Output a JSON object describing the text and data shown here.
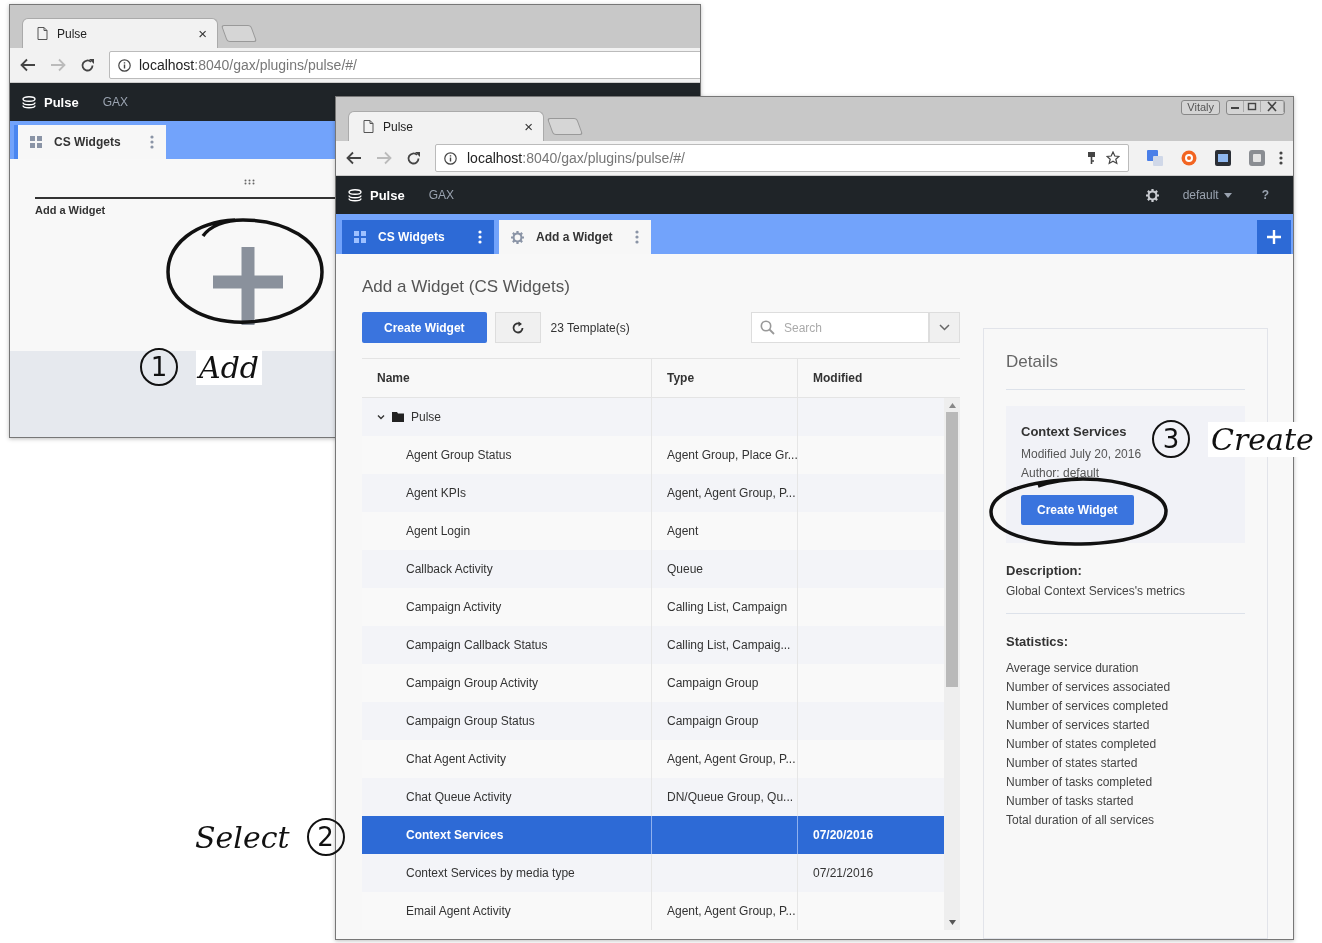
{
  "back_window": {
    "tab": {
      "title": "Pulse",
      "close": "×"
    },
    "address": {
      "host": "localhost",
      "path": ":8040/gax/plugins/pulse/#/"
    },
    "app_name": "Pulse",
    "nav_link": "GAX",
    "tabs": [
      {
        "label": "CS Widgets",
        "selected": true
      }
    ],
    "widget_label": "Add a Widget"
  },
  "front_window": {
    "user_badge": "Vitaly",
    "tab": {
      "title": "Pulse",
      "close": "×"
    },
    "address": {
      "host": "localhost",
      "path": ":8040/gax/plugins/pulse/#/"
    },
    "app_name": "Pulse",
    "nav_link": "GAX",
    "user_menu": "default",
    "help": "?",
    "tabs": [
      {
        "label": "CS Widgets",
        "kind": "grid",
        "selected": false
      },
      {
        "label": "Add a Widget",
        "kind": "gear",
        "selected": true
      }
    ],
    "page_title": "Add a Widget (CS Widgets)",
    "create_button": "Create Widget",
    "template_count": "23 Template(s)",
    "search": {
      "placeholder": "Search"
    },
    "table": {
      "columns": [
        "Name",
        "Type",
        "Modified"
      ],
      "rows": [
        {
          "name": "Pulse",
          "kind": "folder",
          "expanded": true,
          "children": [
            {
              "name": "Agent Group Status",
              "type": "Agent Group, Place Gr...",
              "selected": false
            },
            {
              "name": "Agent KPIs",
              "type": "Agent, Agent Group, P...",
              "selected": false
            },
            {
              "name": "Agent Login",
              "type": "Agent",
              "selected": false
            },
            {
              "name": "Callback Activity",
              "type": "Queue",
              "selected": false
            },
            {
              "name": "Campaign Activity",
              "type": "Calling List, Campaign",
              "selected": false
            },
            {
              "name": "Campaign Callback Status",
              "type": "Calling List, Campaig...",
              "selected": false
            },
            {
              "name": "Campaign Group Activity",
              "type": "Campaign Group",
              "selected": false
            },
            {
              "name": "Campaign Group Status",
              "type": "Campaign Group",
              "selected": false
            },
            {
              "name": "Chat Agent Activity",
              "type": "Agent, Agent Group, P...",
              "selected": false
            },
            {
              "name": "Chat Queue Activity",
              "type": "DN/Queue Group, Qu...",
              "selected": false
            },
            {
              "name": "Context Services",
              "modified": "07/20/2016",
              "selected": true
            },
            {
              "name": "Context Services by media type",
              "modified": "07/21/2016",
              "selected": false
            },
            {
              "name": "Email Agent Activity",
              "type": "Agent, Agent Group, P...",
              "selected": false
            }
          ]
        }
      ]
    },
    "details": {
      "title": "Details",
      "template_name": "Context Services",
      "modified": "Modified July 20, 2016",
      "author": "Author: default",
      "create_button": "Create Widget",
      "description_label": "Description:",
      "description": "Global Context Services's metrics",
      "statistics_label": "Statistics:",
      "statistics": [
        "Average service duration",
        "Number of services associated",
        "Number of services completed",
        "Number of services started",
        "Number of states completed",
        "Number of states started",
        "Number of tasks completed",
        "Number of tasks started",
        "Total duration of all services"
      ]
    }
  },
  "annotations": [
    {
      "number": "1",
      "label": "Add"
    },
    {
      "number": "2",
      "label": "Select"
    },
    {
      "number": "3",
      "label": "Create"
    }
  ]
}
